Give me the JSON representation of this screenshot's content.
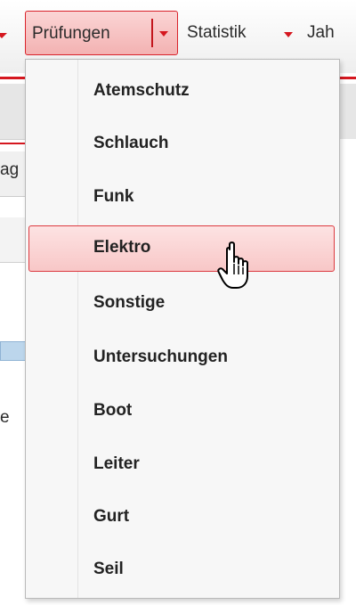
{
  "menubar": {
    "pruefungen_label": "Prüfungen",
    "statistik_label": "Statistik",
    "jahr_label": "Jah"
  },
  "background": {
    "fragment_ag": "ag",
    "fragment_e": "e"
  },
  "dropdown": {
    "items": [
      {
        "label": "Atemschutz"
      },
      {
        "label": "Schlauch"
      },
      {
        "label": "Funk"
      },
      {
        "label": "Elektro"
      },
      {
        "label": "Sonstige"
      },
      {
        "label": "Untersuchungen"
      },
      {
        "label": "Boot"
      },
      {
        "label": "Leiter"
      },
      {
        "label": "Gurt"
      },
      {
        "label": "Seil"
      }
    ],
    "active_item": "Elektro"
  },
  "colors": {
    "accent_red": "#d5171f",
    "highlight_bg": "#fbd5d5"
  },
  "icons": {
    "cursor": "hand-pointer-icon",
    "dropdown_caret": "caret-down-icon"
  }
}
